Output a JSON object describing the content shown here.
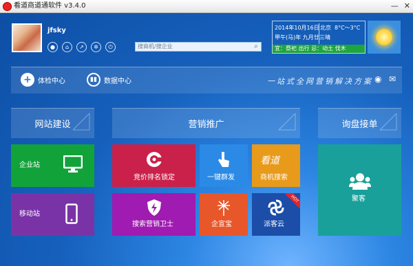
{
  "titlebar": {
    "title": "看道商道通软件  v3.4.0",
    "minimize": "—",
    "close": "✕"
  },
  "user": {
    "name": "jfsky"
  },
  "search": {
    "placeholder": "搜商机/搜企业"
  },
  "calendar": {
    "date": "2014年10月16日",
    "lunar": "甲午(马)年 九月廿三",
    "city": "北京",
    "temp": "8°C～3°C",
    "condition": "晴",
    "almanac": "宜：祭祀 出行  忌：动土 伐木"
  },
  "toolbar": {
    "checkup_label": "体检中心",
    "data_label": "数据中心",
    "slogan": "一站式全网营销解决方案"
  },
  "categories": {
    "website": "网站建设",
    "marketing": "营销推广",
    "inquiry": "询盘接单"
  },
  "tiles": {
    "enterprise_site": "企业站",
    "mobile_site": "移动站",
    "ranking": "竞价排名锁定",
    "one_click": "一键群发",
    "opportunity_search": "商机搜索",
    "opportunity_logo": "看道",
    "guard": "搜索营销卫士",
    "promo": "企宣宝",
    "paike": "派客云",
    "paike_badge": "HOT",
    "juke": "聚客"
  },
  "colors": {
    "green": "#12a23a",
    "purple": "#7a33a7",
    "crimson": "#c9214a",
    "blue_tile": "#2b8ae6",
    "orange": "#e89a1a",
    "magenta": "#a01bb1",
    "orange_red": "#e8572a",
    "navy": "#1c4ea9",
    "teal": "#1aa09a",
    "almanac_green": "#1fa53f"
  },
  "icons": [
    "user-icon",
    "home-icon",
    "pin-icon",
    "gear-icon",
    "power-icon",
    "search-icon",
    "plus-icon",
    "bar-chart-icon",
    "weibo-icon",
    "wechat-icon",
    "monitor-icon",
    "phone-icon",
    "target-icon",
    "hand-touch-icon",
    "shield-icon",
    "dandelion-icon",
    "cloud-link-icon",
    "group-icon"
  ]
}
